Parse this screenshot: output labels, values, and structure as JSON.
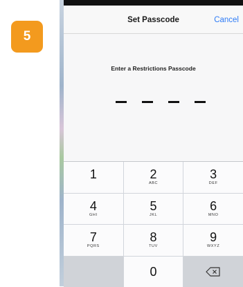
{
  "step": {
    "number": "5",
    "color": "#f39a1e"
  },
  "nav": {
    "title": "Set Passcode",
    "cancel": "Cancel",
    "accent": "#2f7cf6"
  },
  "prompt": "Enter a Restrictions Passcode",
  "passcode_slots": 4,
  "keypad": {
    "keys": [
      {
        "digit": "1",
        "letters": ""
      },
      {
        "digit": "2",
        "letters": "ABC"
      },
      {
        "digit": "3",
        "letters": "DEF"
      },
      {
        "digit": "4",
        "letters": "GHI"
      },
      {
        "digit": "5",
        "letters": "JKL"
      },
      {
        "digit": "6",
        "letters": "MNO"
      },
      {
        "digit": "7",
        "letters": "PQRS"
      },
      {
        "digit": "8",
        "letters": "TUV"
      },
      {
        "digit": "9",
        "letters": "WXYZ"
      }
    ],
    "zero": {
      "digit": "0"
    },
    "delete_icon": "backspace-icon"
  }
}
